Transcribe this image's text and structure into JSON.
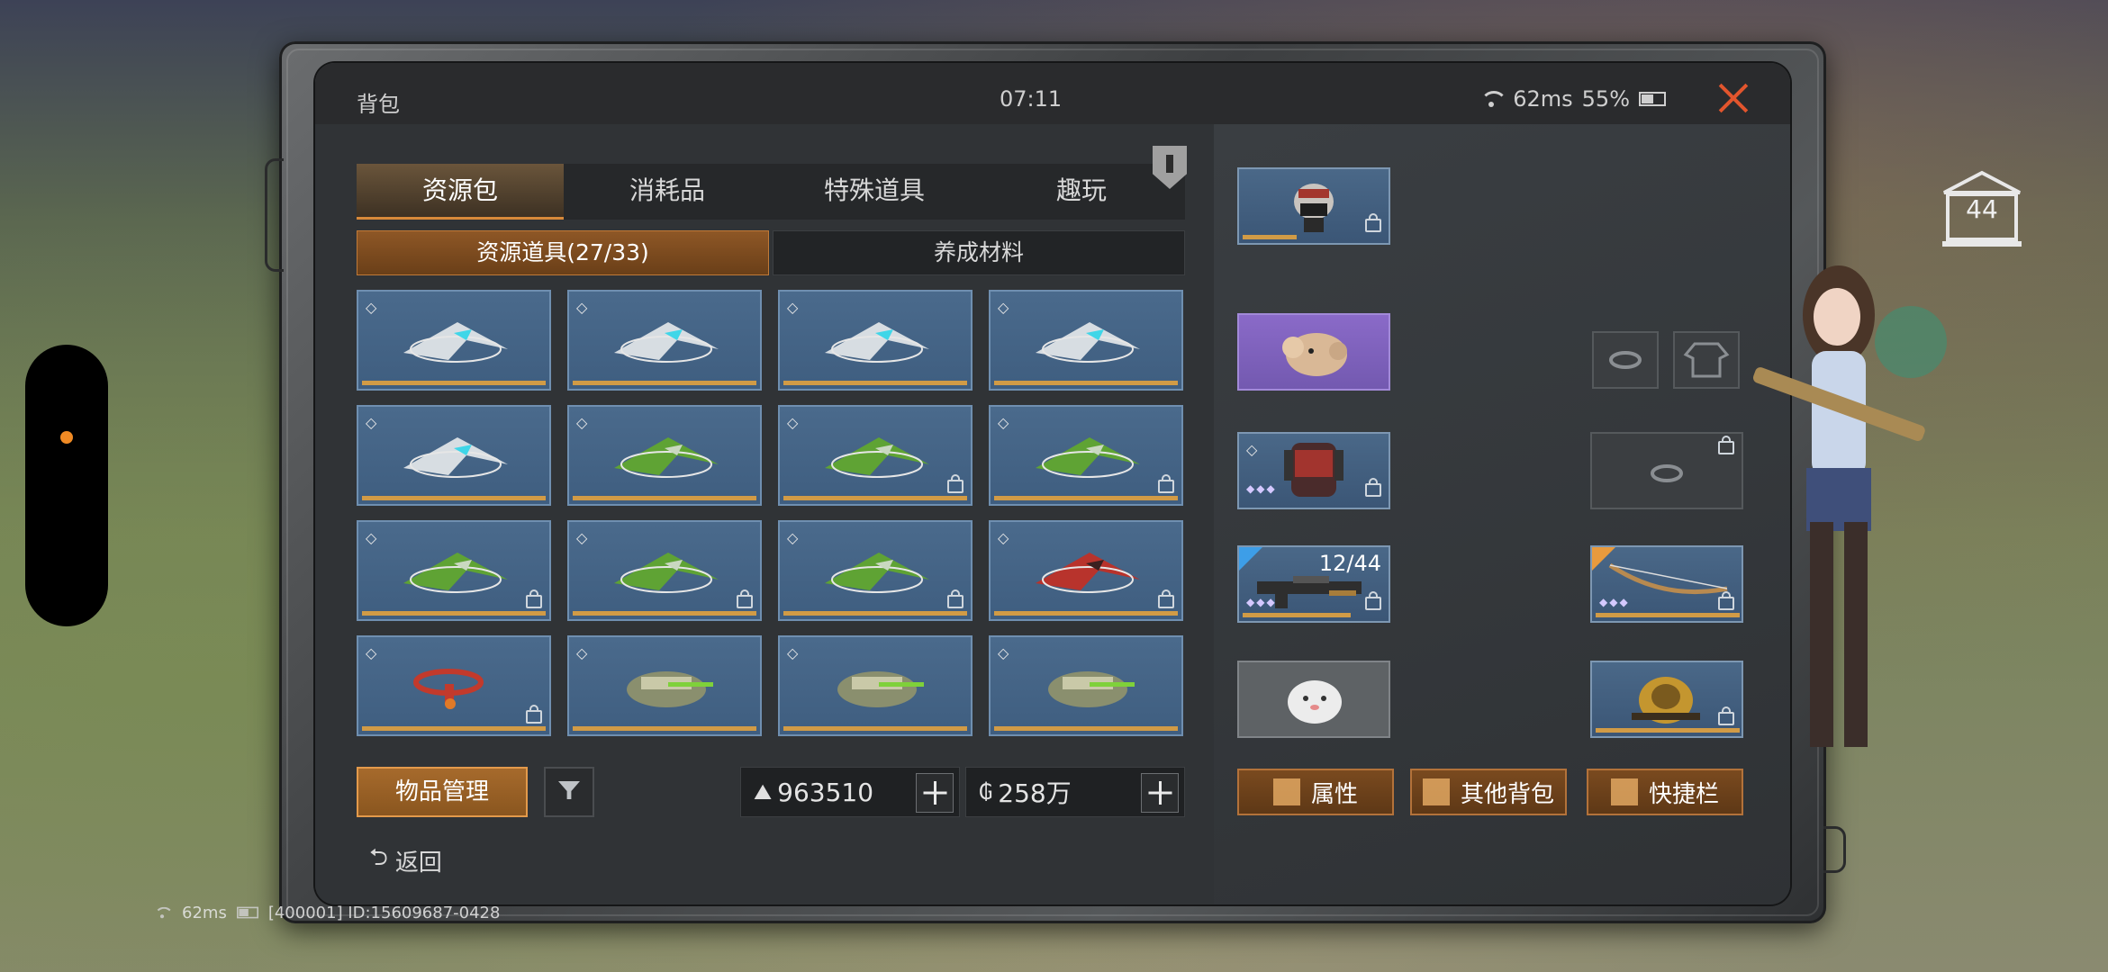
{
  "window": {
    "title": "背包",
    "clock": "07:11",
    "ping": "62ms",
    "battery": "55%"
  },
  "tabs": [
    {
      "label": "资源包",
      "active": true
    },
    {
      "label": "消耗品",
      "active": false
    },
    {
      "label": "特殊道具",
      "active": false
    },
    {
      "label": "趣玩",
      "active": false
    }
  ],
  "subtabs": [
    {
      "label": "资源道具(27/33)",
      "active": true
    },
    {
      "label": "养成材料",
      "active": false
    }
  ],
  "grid_items": [
    {
      "icon": "silver-glider-icon",
      "locked": false
    },
    {
      "icon": "silver-glider-icon",
      "locked": false
    },
    {
      "icon": "silver-glider-icon",
      "locked": false
    },
    {
      "icon": "silver-glider-icon",
      "locked": false
    },
    {
      "icon": "silver-glider-icon",
      "locked": false
    },
    {
      "icon": "green-glider-icon",
      "locked": false
    },
    {
      "icon": "green-glider-icon",
      "locked": true
    },
    {
      "icon": "green-glider-icon",
      "locked": true
    },
    {
      "icon": "green-glider-icon",
      "locked": true
    },
    {
      "icon": "green-glider-icon",
      "locked": true
    },
    {
      "icon": "green-glider-icon",
      "locked": true
    },
    {
      "icon": "red-glider-icon",
      "locked": true
    },
    {
      "icon": "red-ring-glider-icon",
      "locked": true
    },
    {
      "icon": "armored-hovercraft-icon",
      "locked": false
    },
    {
      "icon": "armored-hovercraft-icon",
      "locked": false
    },
    {
      "icon": "armored-hovercraft-icon",
      "locked": false
    }
  ],
  "bottom": {
    "manage_label": "物品管理",
    "currency1_icon": "triangle-gem-icon",
    "currency1_value": "963510",
    "currency2_icon": "gold-coin-icon",
    "currency2_value": "258万",
    "back_label": "返回"
  },
  "equipment": {
    "level": "44",
    "weapon_ammo": "12/44",
    "slots": [
      {
        "name": "helmet-slot",
        "icon": "masked-helmet-icon"
      },
      {
        "name": "pet-slot",
        "icon": "plush-bear-icon"
      },
      {
        "name": "armor-slot",
        "icon": "red-armor-icon"
      },
      {
        "name": "weapon-slot",
        "icon": "rifle-icon"
      },
      {
        "name": "charm-slot",
        "icon": "white-blob-charm-icon"
      },
      {
        "name": "bow-slot",
        "icon": "bow-icon"
      },
      {
        "name": "backpack-slot",
        "icon": "golden-pack-icon"
      }
    ]
  },
  "actions": [
    {
      "label": "属性",
      "icon": "attribute-icon"
    },
    {
      "label": "其他背包",
      "icon": "backpack-icon"
    },
    {
      "label": "快捷栏",
      "icon": "hotbar-icon"
    }
  ],
  "footer": {
    "ping": "62ms",
    "server_id": "[400001] ID:15609687-0428"
  },
  "colors": {
    "accent_orange": "#d8893a",
    "cell_blue": "#4a6a8c",
    "close_red": "#e2552d"
  }
}
